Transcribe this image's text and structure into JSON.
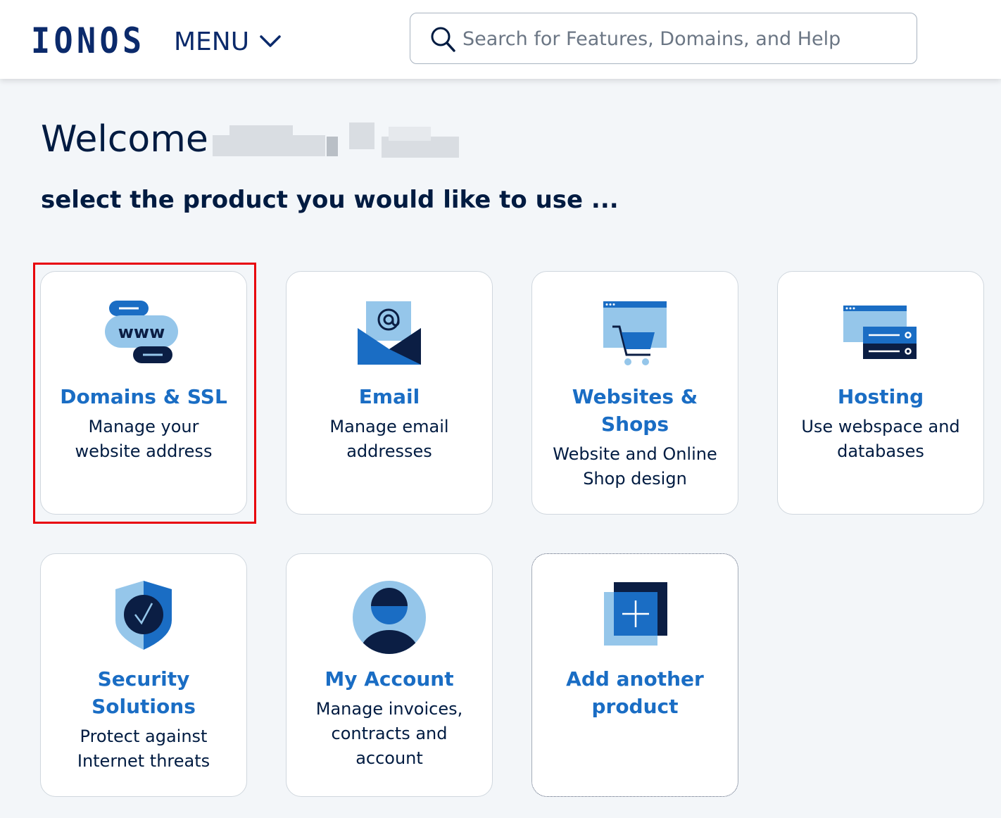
{
  "header": {
    "logo": "IONOS",
    "menu_label": "MENU",
    "search_placeholder": "Search for Features, Domains, and Help"
  },
  "welcome": {
    "greeting": "Welcome",
    "subtitle": "select the product you would like to use ..."
  },
  "cards": [
    {
      "title": "Domains & SSL",
      "description": "Manage your website address",
      "icon": "www-domain-icon",
      "selected": true
    },
    {
      "title": "Email",
      "description": "Manage email addresses",
      "icon": "envelope-at-icon"
    },
    {
      "title": "Websites & Shops",
      "description": "Website and Online Shop design",
      "icon": "website-cart-icon"
    },
    {
      "title": "Hosting",
      "description": "Use webspace and databases",
      "icon": "server-icon"
    },
    {
      "title": "Security Solutions",
      "description": "Protect against Internet threats",
      "icon": "shield-check-icon"
    },
    {
      "title": "My Account",
      "description": "Manage invoices, contracts and account",
      "icon": "user-avatar-icon"
    },
    {
      "title": "Add another product",
      "description": "",
      "icon": "add-plus-icon"
    }
  ],
  "colors": {
    "brand": "#0b2a6b",
    "accent": "#1a6dc4",
    "light_blue": "#95c6ea",
    "navy": "#0b1e44",
    "highlight": "#e8000b",
    "background": "#f3f6f9"
  }
}
